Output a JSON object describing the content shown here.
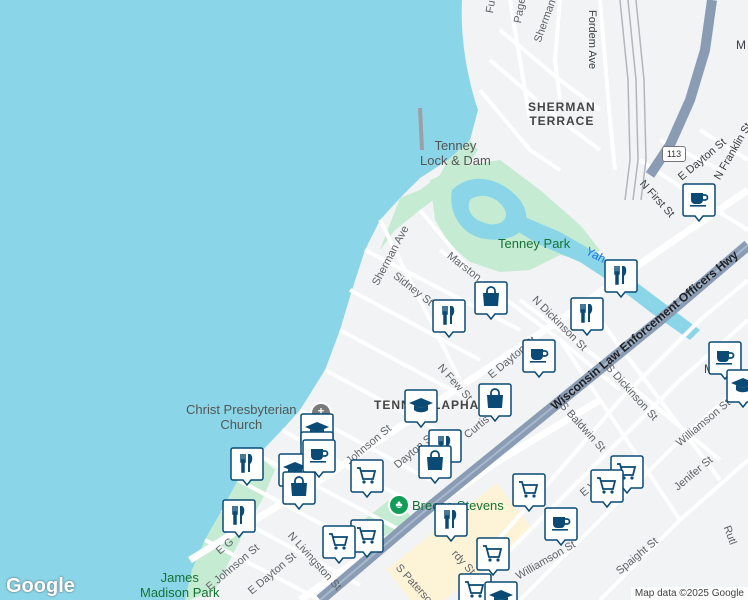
{
  "map": {
    "attribution": "Map data ©2025 Google",
    "logo": "Google",
    "colors": {
      "water": "#8ad6e8",
      "park": "#c5ebd2",
      "land": "#f1f3f4",
      "road": "#ffffff",
      "highway": "#8a9cb4",
      "pin": "#0a4a74",
      "rail": "#9aa0a6"
    }
  },
  "neighborhoods": [
    {
      "text": "SHERMAN\nTERRACE"
    },
    {
      "text": "TENNEY-LAPHAM"
    }
  ],
  "parks": [
    {
      "text": "Tenney Park"
    },
    {
      "text": "Breese Stevens"
    },
    {
      "text": "James\nMadison Park"
    }
  ],
  "water_labels": [
    {
      "text": "Yah"
    }
  ],
  "pois": [
    {
      "text": "Tenney\nLock & Dam"
    },
    {
      "text": "Christ Presbyterian\nChurch"
    }
  ],
  "highway_shield": "113",
  "streets": [
    {
      "text": "Fordem Ave"
    },
    {
      "text": "Sherman Ave"
    },
    {
      "text": "Sidney St"
    },
    {
      "text": "Marston"
    },
    {
      "text": "N Dickinson St"
    },
    {
      "text": "E Dayton St"
    },
    {
      "text": "N Few St"
    },
    {
      "text": "N First St"
    },
    {
      "text": "Wisconsin Law Enforcement Officers Hwy"
    },
    {
      "text": "S Dickinson St"
    },
    {
      "text": "S Baldwin St"
    },
    {
      "text": "Williamson St"
    },
    {
      "text": "Jenifer St"
    },
    {
      "text": "Spaight St"
    },
    {
      "text": "S Paterson St"
    },
    {
      "text": "Williamson St"
    },
    {
      "text": "N Livingston St"
    },
    {
      "text": "E Dayton St"
    },
    {
      "text": "E Johnson St"
    },
    {
      "text": "Curtis C"
    },
    {
      "text": "Dayton St"
    },
    {
      "text": "Johnson St"
    },
    {
      "text": "E G"
    },
    {
      "text": "Pagel"
    },
    {
      "text": "Sherman"
    },
    {
      "text": "Fu"
    },
    {
      "text": "E Dayton St"
    },
    {
      "text": "N Franklin St"
    },
    {
      "text": "Rutl"
    },
    {
      "text": "E W"
    },
    {
      "text": "rdy St"
    }
  ],
  "edge_labels": [
    {
      "text": "M"
    },
    {
      "text": "M"
    }
  ],
  "markers": [
    {
      "type": "coffee-icon"
    },
    {
      "type": "restaurant-icon"
    },
    {
      "type": "restaurant-icon"
    },
    {
      "type": "shopping-bag-icon"
    },
    {
      "type": "restaurant-icon"
    },
    {
      "type": "coffee-icon"
    },
    {
      "type": "coffee-icon"
    },
    {
      "type": "graduation-cap-icon"
    },
    {
      "type": "graduation-cap-icon"
    },
    {
      "type": "shopping-bag-icon"
    },
    {
      "type": "graduation-cap-icon"
    },
    {
      "type": "restaurant-icon"
    },
    {
      "type": "shopping-bag-icon"
    },
    {
      "type": "shopping-cart-icon"
    },
    {
      "type": "graduation-cap-icon"
    },
    {
      "type": "graduation-cap-icon"
    },
    {
      "type": "restaurant-icon"
    },
    {
      "type": "shopping-bag-icon"
    },
    {
      "type": "restaurant-icon"
    },
    {
      "type": "shopping-cart-icon"
    },
    {
      "type": "shopping-cart-icon"
    },
    {
      "type": "shopping-cart-icon"
    },
    {
      "type": "restaurant-icon"
    },
    {
      "type": "shopping-cart-icon"
    },
    {
      "type": "coffee-icon"
    },
    {
      "type": "shopping-cart-icon"
    },
    {
      "type": "shopping-cart-icon"
    },
    {
      "type": "shopping-cart-icon"
    },
    {
      "type": "graduation-cap-icon"
    },
    {
      "type": "coffee-icon"
    }
  ]
}
